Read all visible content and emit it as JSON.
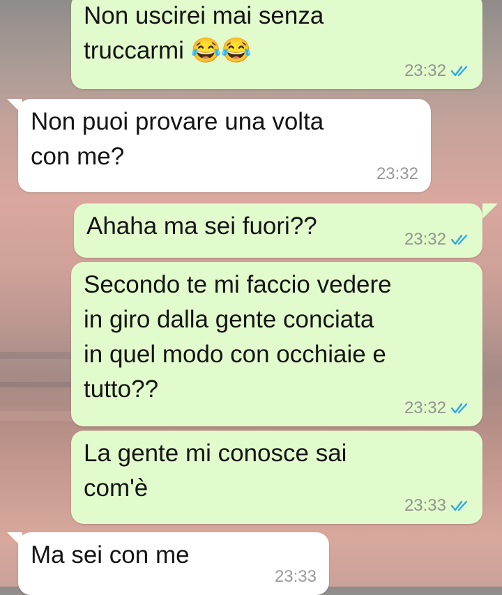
{
  "chat": {
    "messages": [
      {
        "direction": "outgoing",
        "text": "Non uscirei mai senza\ntruccarmi 😂😂",
        "time": "23:32",
        "status": "read",
        "status_icon": "double-check-icon",
        "status_color": "#2aa8e8"
      },
      {
        "direction": "incoming",
        "text": "Non puoi provare una volta\ncon me?",
        "time": "23:32"
      },
      {
        "direction": "outgoing",
        "text": "Ahaha ma sei fuori??",
        "time": "23:32",
        "status": "read",
        "status_icon": "double-check-icon",
        "status_color": "#2aa8e8"
      },
      {
        "direction": "outgoing",
        "text": "Secondo te mi faccio vedere\nin giro dalla gente conciata\nin quel modo con occhiaie e\ntutto??",
        "time": "23:32",
        "status": "read",
        "status_icon": "double-check-icon",
        "status_color": "#2aa8e8"
      },
      {
        "direction": "outgoing",
        "text": "La gente mi conosce sai\ncom'è",
        "time": "23:33",
        "status": "read",
        "status_icon": "double-check-icon",
        "status_color": "#2aa8e8"
      },
      {
        "direction": "incoming",
        "text": "Ma sei con me",
        "time": "23:33"
      }
    ]
  },
  "colors": {
    "outgoing_bubble": "#e2fbcc",
    "incoming_bubble": "#ffffff",
    "timestamp": "#8f958f",
    "read_tick": "#2aa8e8"
  }
}
